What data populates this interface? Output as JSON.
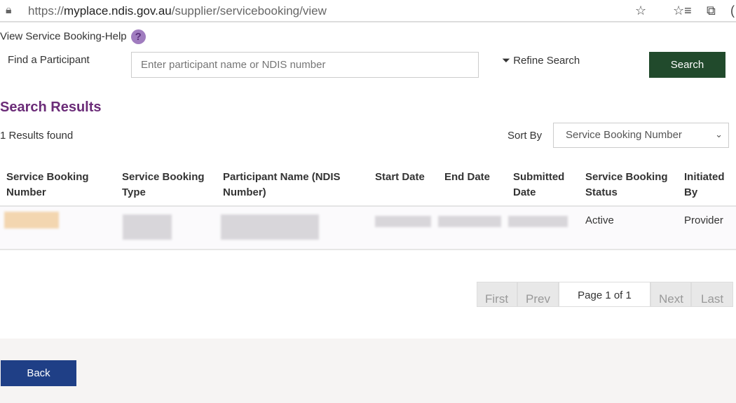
{
  "browser": {
    "url_prefix": "https://",
    "url_domain": "myplace.ndis.gov.au",
    "url_path": "/supplier/servicebooking/view",
    "lock_icon": "lock-icon",
    "star_icon": "star-icon",
    "favorites_icon": "favorites-icon",
    "collections_icon": "collections-icon"
  },
  "page": {
    "help_label": "View Service Booking-Help",
    "help_icon": "?"
  },
  "search": {
    "label": "Find a Participant",
    "placeholder": "Enter participant name or NDIS number",
    "refine_label": "Refine Search",
    "button_label": "Search"
  },
  "results": {
    "title": "Search Results",
    "count": "1 Results found",
    "sort_label": "Sort By",
    "sort_value": "Service Booking Number",
    "columns": [
      "Service Booking Number",
      "Service Booking Type",
      "Participant Name (NDIS Number)",
      "Start Date",
      "End Date",
      "Submitted Date",
      "Service Booking Status",
      "Initiated By"
    ],
    "rows": [
      {
        "status": "Active",
        "initiated_by": "Provider"
      }
    ]
  },
  "pagination": {
    "first": "First",
    "prev": "Prev",
    "current": "Page 1 of 1",
    "next": "Next",
    "last": "Last"
  },
  "footer": {
    "back_label": "Back"
  },
  "colors": {
    "search_button": "#214a2c",
    "back_button": "#1f3f86",
    "heading": "#6b2c78"
  }
}
